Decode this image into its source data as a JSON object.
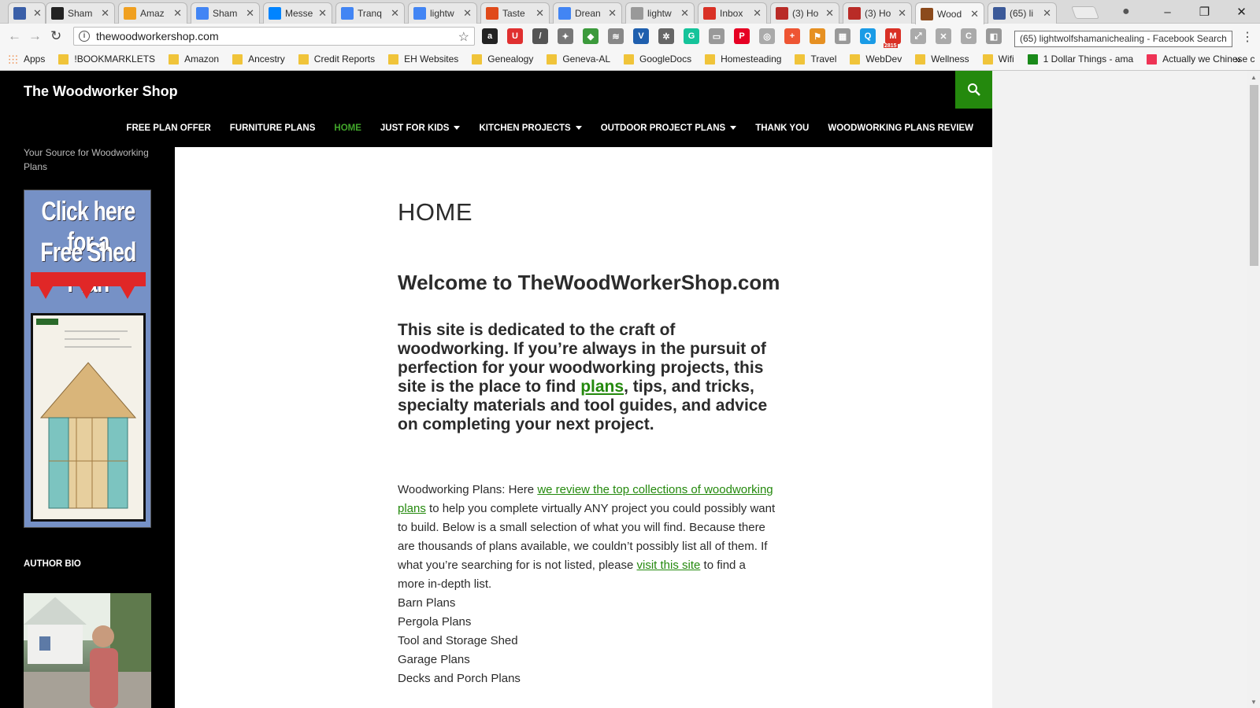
{
  "browser": {
    "tabs": [
      {
        "title": "",
        "favicon": "vivaldi-icon",
        "fav_color": "#3a5fa8",
        "active": false
      },
      {
        "title": "Sham",
        "favicon": "amazon-icon",
        "fav_color": "#222222",
        "active": false
      },
      {
        "title": "Amaz",
        "favicon": "amazon-icon",
        "fav_color": "#f0a020",
        "active": false
      },
      {
        "title": "Sham",
        "favicon": "google-icon",
        "fav_color": "#4285f4",
        "active": false
      },
      {
        "title": "Messe",
        "favicon": "messenger-icon",
        "fav_color": "#0084ff",
        "active": false
      },
      {
        "title": "Tranq",
        "favicon": "google-icon",
        "fav_color": "#4285f4",
        "active": false
      },
      {
        "title": "lightw",
        "favicon": "google-icon",
        "fav_color": "#4285f4",
        "active": false
      },
      {
        "title": "Taste",
        "favicon": "chart-icon",
        "fav_color": "#e04a1a",
        "active": false
      },
      {
        "title": "Drean",
        "favicon": "google-icon",
        "fav_color": "#4285f4",
        "active": false
      },
      {
        "title": "lightw",
        "favicon": "page-icon",
        "fav_color": "#999999",
        "active": false
      },
      {
        "title": "Inbox",
        "favicon": "gmail-icon",
        "fav_color": "#d93025",
        "active": false
      },
      {
        "title": "(3) Ho",
        "favicon": "quora-icon",
        "fav_color": "#b92b27",
        "active": false
      },
      {
        "title": "(3) Ho",
        "favicon": "quora-icon",
        "fav_color": "#b92b27",
        "active": false
      },
      {
        "title": "Wood",
        "favicon": "wood-icon",
        "fav_color": "#8b4a1c",
        "active": true
      },
      {
        "title": "(65) li",
        "favicon": "facebook-icon",
        "fav_color": "#3b5998",
        "active": false
      }
    ],
    "url": "thewoodworkershop.com",
    "tooltip": "(65) lightwolfshamanichealing - Facebook Search",
    "extensions": [
      {
        "name": "amazon-ext-icon",
        "color": "#222222",
        "glyph": "a"
      },
      {
        "name": "magnet-ext-icon",
        "color": "#e03030",
        "glyph": "U"
      },
      {
        "name": "eyedropper-ext-icon",
        "color": "#555555",
        "glyph": "/"
      },
      {
        "name": "puzzle-ext-icon",
        "color": "#777777",
        "glyph": "✦"
      },
      {
        "name": "shield-ext-icon",
        "color": "#3c9a3c",
        "glyph": "◆"
      },
      {
        "name": "signal-ext-icon",
        "color": "#888888",
        "glyph": "≋"
      },
      {
        "name": "v-ext-icon",
        "color": "#1f5fae",
        "glyph": "V"
      },
      {
        "name": "gear-ext-icon",
        "color": "#666666",
        "glyph": "✲"
      },
      {
        "name": "grammarly-ext-icon",
        "color": "#15c39a",
        "glyph": "G"
      },
      {
        "name": "screen-ext-icon",
        "color": "#999999",
        "glyph": "▭"
      },
      {
        "name": "pinterest-ext-icon",
        "color": "#e60023",
        "glyph": "P"
      },
      {
        "name": "circle-ext-icon",
        "color": "#aaaaaa",
        "glyph": "◎"
      },
      {
        "name": "plus-ext-icon",
        "color": "#ee5533",
        "glyph": "+"
      },
      {
        "name": "flag-ext-icon",
        "color": "#e69022",
        "glyph": "⚑"
      },
      {
        "name": "grid-ext-icon",
        "color": "#999999",
        "glyph": "▦"
      },
      {
        "name": "search-ext-icon",
        "color": "#1a9be6",
        "glyph": "Q"
      },
      {
        "name": "mail-ext-icon",
        "color": "#d93025",
        "glyph": "M",
        "badge": "2815"
      },
      {
        "name": "leaf-ext-icon",
        "color": "#aaaaaa",
        "glyph": "⤢"
      },
      {
        "name": "x-ext-icon",
        "color": "#aaaaaa",
        "glyph": "✕"
      },
      {
        "name": "c-ext-icon",
        "color": "#aaaaaa",
        "glyph": "C"
      },
      {
        "name": "panel-ext-icon",
        "color": "#999999",
        "glyph": "◧"
      }
    ],
    "bookmarks": [
      {
        "label": "Apps",
        "type": "apps"
      },
      {
        "label": "!BOOKMARKLETS",
        "type": "folder"
      },
      {
        "label": "Amazon",
        "type": "folder"
      },
      {
        "label": "Ancestry",
        "type": "folder"
      },
      {
        "label": "Credit Reports",
        "type": "folder"
      },
      {
        "label": "EH Websites",
        "type": "folder"
      },
      {
        "label": "Genealogy",
        "type": "folder"
      },
      {
        "label": "Geneva-AL",
        "type": "folder"
      },
      {
        "label": "GoogleDocs",
        "type": "folder"
      },
      {
        "label": "Homesteading",
        "type": "folder"
      },
      {
        "label": "Travel",
        "type": "folder"
      },
      {
        "label": "WebDev",
        "type": "folder"
      },
      {
        "label": "Wellness",
        "type": "folder"
      },
      {
        "label": "Wifi",
        "type": "folder"
      },
      {
        "label": "1 Dollar Things - ama",
        "type": "link"
      },
      {
        "label": "Actually we Chinese c",
        "type": "link"
      }
    ],
    "bookmarks_more": "»"
  },
  "site": {
    "title": "The Woodworker Shop",
    "tagline": "Your Source for Woodworking Plans",
    "nav": [
      {
        "label": "FREE PLAN OFFER",
        "active": false,
        "dropdown": false
      },
      {
        "label": "FURNITURE PLANS",
        "active": false,
        "dropdown": false
      },
      {
        "label": "HOME",
        "active": true,
        "dropdown": false
      },
      {
        "label": "JUST FOR KIDS",
        "active": false,
        "dropdown": true
      },
      {
        "label": "KITCHEN PROJECTS",
        "active": false,
        "dropdown": true
      },
      {
        "label": "OUTDOOR PROJECT PLANS",
        "active": false,
        "dropdown": true
      },
      {
        "label": "THANK YOU",
        "active": false,
        "dropdown": false
      },
      {
        "label": "WOODWORKING PLANS REVIEW",
        "active": false,
        "dropdown": false
      }
    ],
    "promo_line1": "Click here for a",
    "promo_line2": "Free Shed Plan",
    "author_heading": "AUTHOR BIO",
    "accent_color": "#24890d"
  },
  "content": {
    "page_title": "HOME",
    "welcome": "Welcome to TheWoodWorkerShop.com",
    "intro_before": "This site is dedicated to the craft of woodworking. If you’re always in the pursuit of perfection for your woodworking projects, this site is the place to find ",
    "intro_link": "plans",
    "intro_after": ", tips, and tricks, specialty materials and tool guides, and advice on completing your next project.",
    "para_prefix": "Woodworking Plans:  Here ",
    "para_link1": "we review the top collections of woodworking plans",
    "para_mid": " to help you complete virtually ANY project you could possibly want to build.  Below is a small selection of what you will find.  Because there are thousands of plans available, we couldn’t possibly list all of them.  If what you’re searching for is not listed, please ",
    "para_link2": "visit this site",
    "para_suffix": " to find a more in-depth list.",
    "plan_list": [
      "Barn Plans",
      "Pergola Plans",
      "Tool and Storage Shed",
      "Garage Plans",
      "Decks and Porch Plans"
    ]
  }
}
